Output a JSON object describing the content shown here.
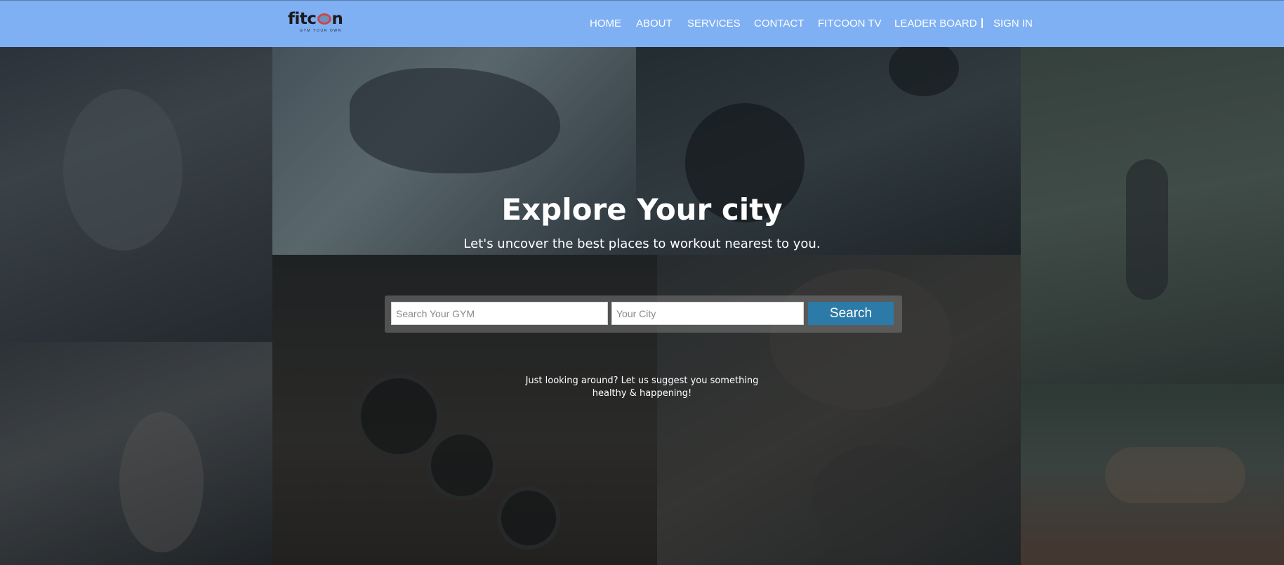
{
  "brand": {
    "name_start": "fitc",
    "name_end": "n",
    "tagline": "GYM YOUR OWN"
  },
  "nav": {
    "items": [
      "HOME",
      "ABOUT",
      "SERVICES",
      "CONTACT",
      "FITCOON TV",
      "LEADER BOARD"
    ],
    "sign_in": "SIGN IN"
  },
  "hero": {
    "title": "Explore Your city",
    "subtitle": "Let's uncover the best places to workout nearest to you."
  },
  "search": {
    "gym_placeholder": "Search Your GYM",
    "city_placeholder": "Your City",
    "button_label": "Search"
  },
  "suggestion": {
    "line1": "Just looking around? Let us suggest you something",
    "line2": "healthy & happening!"
  },
  "colors": {
    "navbar": "#7fb0f3",
    "search_button": "#2c7aa8"
  }
}
